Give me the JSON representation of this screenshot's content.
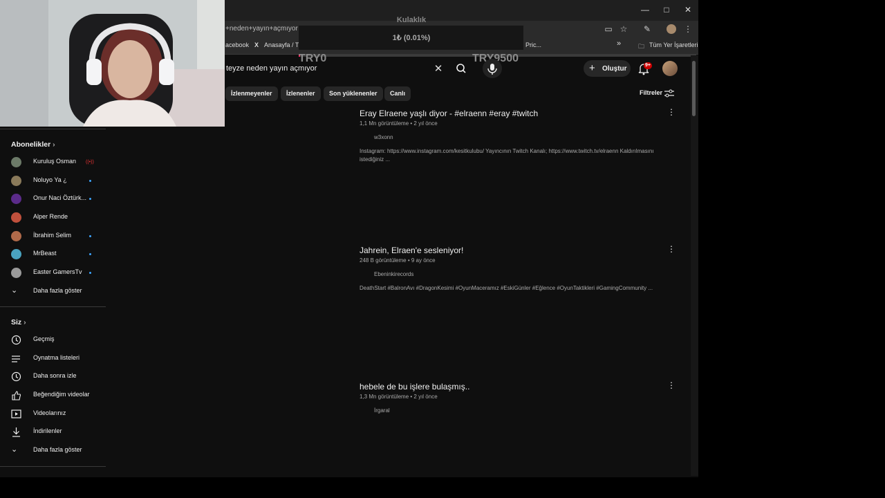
{
  "browser": {
    "url_text": "+neden+yayın+açmıyor",
    "bookmarks": [
      "acebook",
      "Anasayfa / Twi",
      "Pric...",
      "»",
      "Tüm Yer İşaretleri"
    ],
    "window_controls": [
      "minimize",
      "maximize",
      "close"
    ]
  },
  "overlay": {
    "title": "Kulaklık",
    "value": "1₺ (0.01%)",
    "left_label": "TRY0",
    "right_label": "TRY9500",
    "progress_fraction": 0.0001
  },
  "youtube": {
    "search": {
      "query": "teyze neden yayın açmıyor"
    },
    "create_label": "Oluştur",
    "notifications_badge": "9+",
    "chips": [
      "İzlenmeyenler",
      "İzlenenler",
      "Son yüklenenler",
      "Canlı"
    ],
    "filters_label": "Filtreler",
    "sidebar": {
      "subscriptions_heading": "Abonelikler",
      "subscriptions": [
        {
          "label": "Kuruluş Osman",
          "indicator": "live"
        },
        {
          "label": "Noluyo Ya ¿",
          "indicator": "dot"
        },
        {
          "label": "Onur Naci Öztürk...",
          "indicator": "dot"
        },
        {
          "label": "Alper Rende",
          "indicator": ""
        },
        {
          "label": "İbrahim Selim",
          "indicator": "dot"
        },
        {
          "label": "MrBeast",
          "indicator": "dot"
        },
        {
          "label": "Easter GamersTv",
          "indicator": "dot"
        }
      ],
      "subs_more": "Daha fazla göster",
      "you_heading": "Siz",
      "you_items": [
        {
          "label": "Geçmiş",
          "icon": "history-icon"
        },
        {
          "label": "Oynatma listeleri",
          "icon": "playlists-icon"
        },
        {
          "label": "Daha sonra izle",
          "icon": "watch-later-icon"
        },
        {
          "label": "Beğendiğim videolar",
          "icon": "liked-videos-icon"
        },
        {
          "label": "Videolarınız",
          "icon": "your-videos-icon"
        },
        {
          "label": "İndirilenler",
          "icon": "downloads-icon"
        }
      ],
      "you_more": "Daha fazla göster"
    },
    "results": [
      {
        "title": "Eray Elraene yaşlı diyor - #elraenn #eray #twitch",
        "meta": "1,1 Mn görüntüleme • 2 yıl önce",
        "channel": "w3xonn",
        "description": "Instagram: https://www.instagram.com/kesitkulubu/ Yayıncının Twitch Kanalı; https://www.twitch.tv/elraenn Kaldırılmasını istediğiniz ..."
      },
      {
        "title": "Jahrein, Elraen'e sesleniyor!",
        "meta": "248 B görüntüleme • 9 ay önce",
        "channel": "Ebeninkirecords",
        "description": "DeathStart #BalronAvı #DragonKesimi #OyunMaceramız #EskiGünler #Eğlence #OyunTaktikleri #GamingCommunity ..."
      },
      {
        "title": "hebele de bu işlere bulaşmış..",
        "meta": "1,3 Mn görüntüleme • 2 yıl önce",
        "channel": "İrgaral",
        "description": ""
      }
    ]
  }
}
